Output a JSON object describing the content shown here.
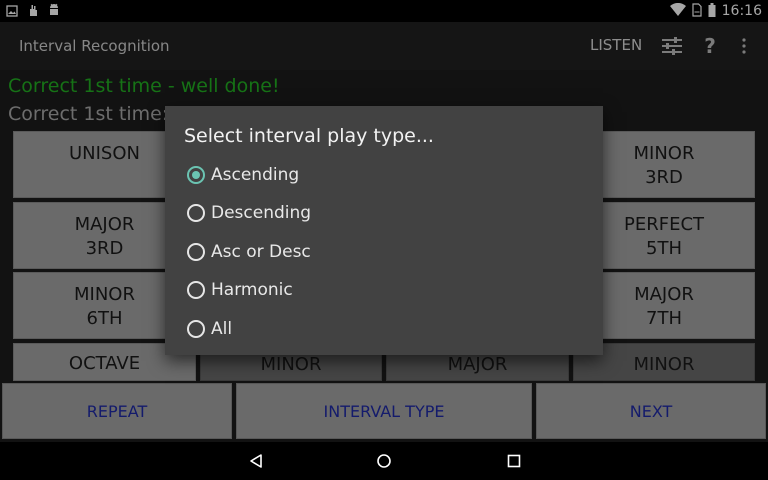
{
  "status_bar": {
    "time": "16:16",
    "left_icons": [
      "image-icon",
      "hand-icon",
      "android-icon"
    ],
    "right_icons": [
      "wifi-icon",
      "no-sim-icon",
      "battery-icon"
    ]
  },
  "action_bar": {
    "title": "Interval Recognition",
    "listen_label": "LISTEN",
    "icons": [
      "settings-sliders-icon",
      "help-icon",
      "overflow-menu-icon"
    ]
  },
  "messages": {
    "correct": "Correct 1st time - well done!",
    "stats": "Correct 1st time:"
  },
  "interval_buttons": {
    "unison": [
      "UNISON"
    ],
    "minor_3rd": [
      "MINOR",
      "3RD"
    ],
    "major_3rd": [
      "MAJOR",
      "3RD"
    ],
    "perfect_5th": [
      "PERFECT",
      "5TH"
    ],
    "minor_6th": [
      "MINOR",
      "6TH"
    ],
    "major_7th": [
      "MAJOR",
      "7TH"
    ],
    "octave": [
      "OCTAVE"
    ],
    "row4_minor_a": [
      "MINOR"
    ],
    "row4_major": [
      "MAJOR"
    ],
    "row4_minor_b": [
      "MINOR"
    ]
  },
  "bottom_buttons": {
    "repeat": "REPEAT",
    "interval_type": "INTERVAL TYPE",
    "next": "NEXT"
  },
  "dialog": {
    "title": "Select interval play type...",
    "options": [
      {
        "label": "Ascending",
        "selected": true
      },
      {
        "label": "Descending",
        "selected": false
      },
      {
        "label": "Asc or Desc",
        "selected": false
      },
      {
        "label": "Harmonic",
        "selected": false
      },
      {
        "label": "All",
        "selected": false
      }
    ]
  },
  "colors": {
    "correct_text": "#22b022",
    "radio_accent": "#6bc4b2",
    "bottom_button_text": "#1f2aa6"
  },
  "nav_bar": {
    "icons": [
      "back-icon",
      "home-icon",
      "recents-icon"
    ]
  }
}
